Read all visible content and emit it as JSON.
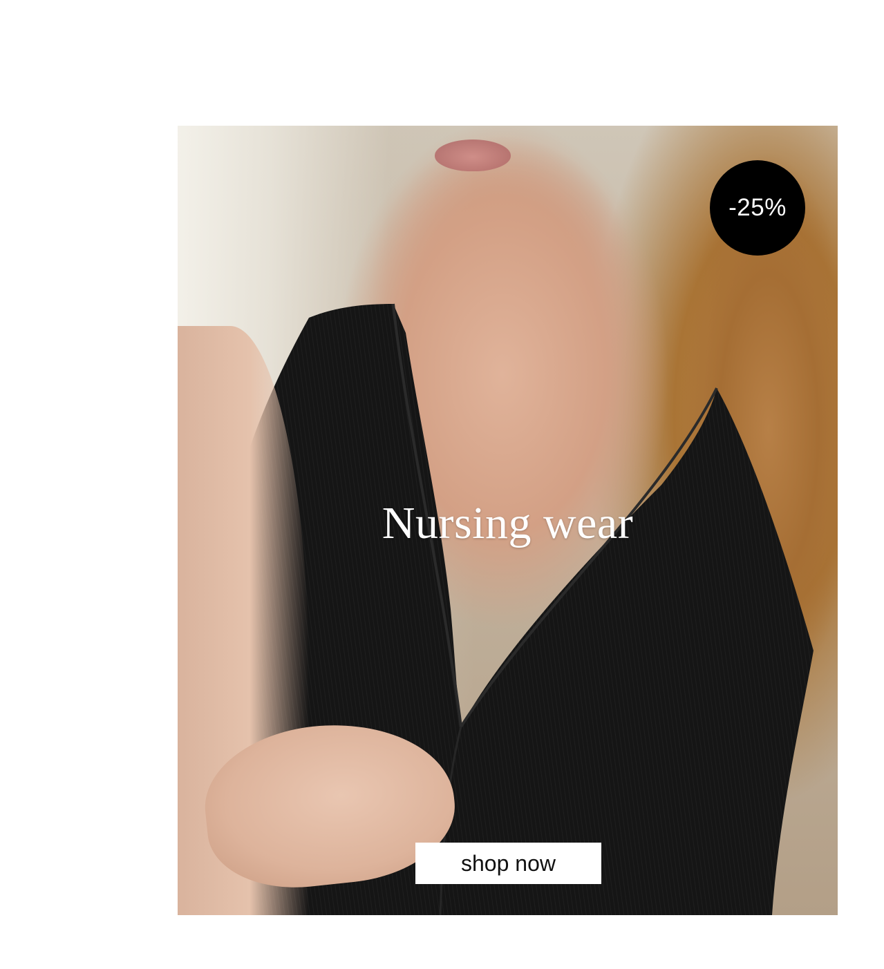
{
  "promo": {
    "title": "Nursing wear",
    "discount_badge": "-25%",
    "cta_label": "shop now",
    "image_alt": "Woman wearing a black sleeveless ribbed nursing top"
  },
  "colors": {
    "background": "#ffffff",
    "badge_bg": "#000000",
    "badge_text": "#ffffff",
    "title_text": "#ffffff",
    "button_bg": "#ffffff",
    "button_text": "#111111",
    "garment": "#141414"
  }
}
